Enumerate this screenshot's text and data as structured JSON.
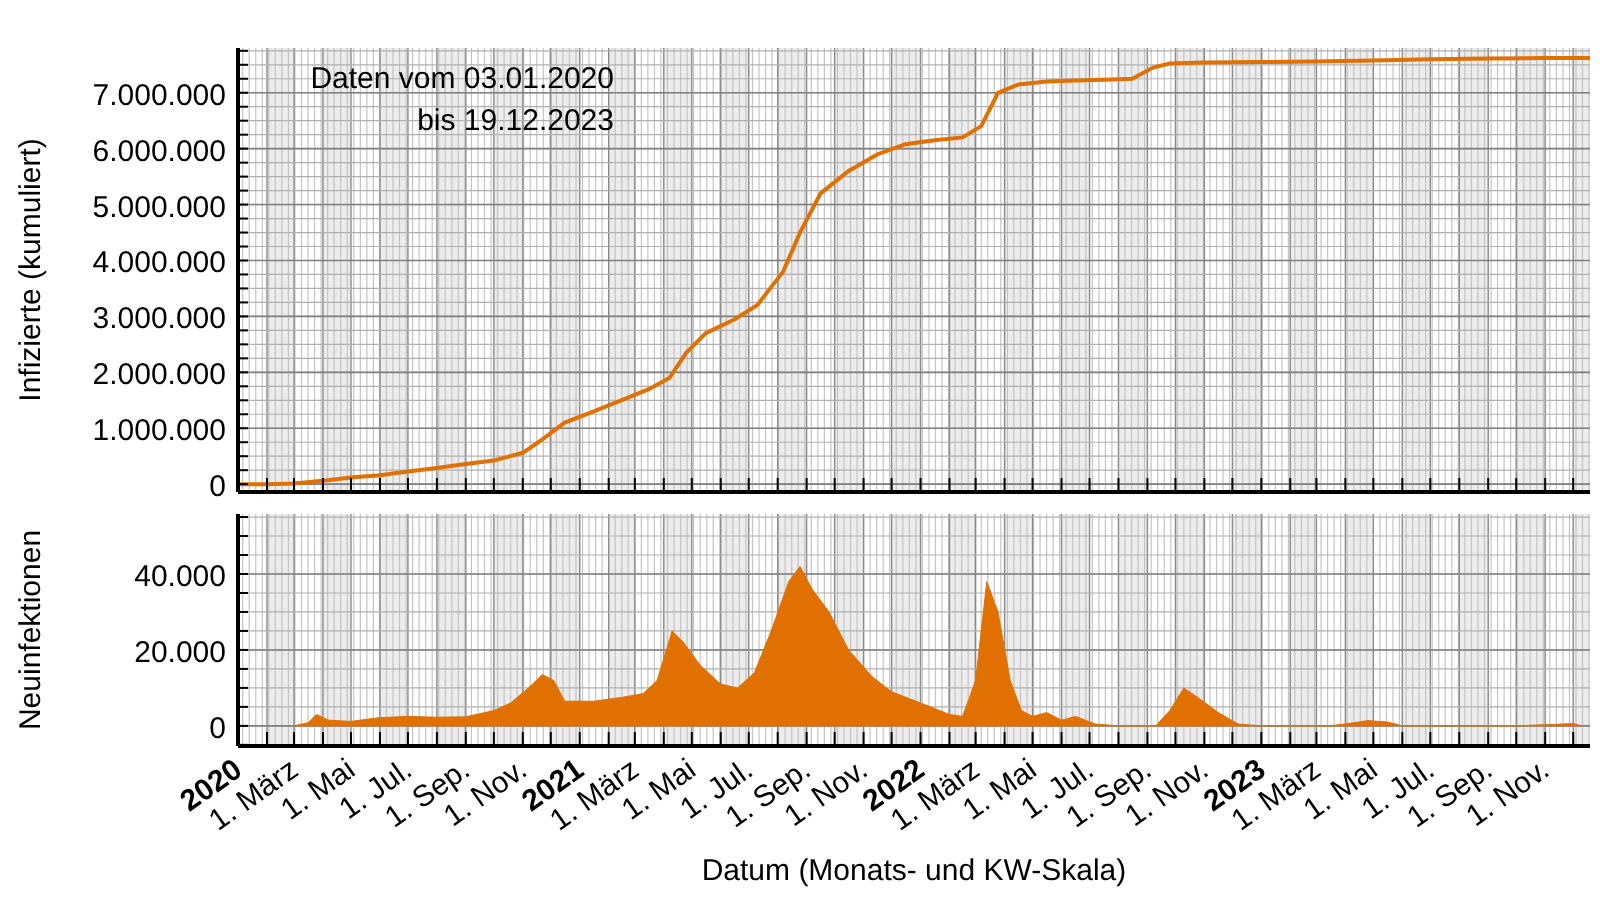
{
  "charts": [
    {
      "chart_data": {
        "type": "line",
        "grid": true,
        "ylabel": "Infizierte (kumuliert)",
        "xlim": [
          "2020-01-01",
          "2023-12-19"
        ],
        "ylim": [
          -140000,
          7800000
        ],
        "yticks": [
          {
            "value": 0,
            "label": "0"
          },
          {
            "value": 1000000,
            "label": "1.000.000"
          },
          {
            "value": 2000000,
            "label": "2.000.000"
          },
          {
            "value": 3000000,
            "label": "3.000.000"
          },
          {
            "value": 4000000,
            "label": "4.000.000"
          },
          {
            "value": 5000000,
            "label": "5.000.000"
          },
          {
            "value": 6000000,
            "label": "6.000.000"
          },
          {
            "value": 7000000,
            "label": "7.000.000"
          }
        ],
        "x": [
          "2020-01-01",
          "2020-02-01",
          "2020-03-01",
          "2020-04-01",
          "2020-05-01",
          "2020-06-01",
          "2020-07-01",
          "2020-08-01",
          "2020-09-01",
          "2020-10-01",
          "2020-11-01",
          "2020-11-22",
          "2020-12-16",
          "2021-01-16",
          "2021-02-15",
          "2021-03-16",
          "2021-04-07",
          "2021-04-25",
          "2021-05-16",
          "2021-06-16",
          "2021-07-10",
          "2021-08-07",
          "2021-08-25",
          "2021-09-16",
          "2021-10-16",
          "2021-11-16",
          "2021-12-16",
          "2022-01-16",
          "2022-02-15",
          "2022-03-07",
          "2022-03-25",
          "2022-04-16",
          "2022-05-16",
          "2022-06-16",
          "2022-07-16",
          "2022-08-16",
          "2022-09-07",
          "2022-09-25",
          "2022-11-01",
          "2023-01-01",
          "2023-03-01",
          "2023-05-01",
          "2023-07-01",
          "2023-09-01",
          "2023-11-01",
          "2023-12-19"
        ],
        "series": [
          {
            "color": "#e07000",
            "values": [
              0,
              0,
              10000,
              60000,
              120000,
              160000,
              230000,
              290000,
              360000,
              420000,
              560000,
              800000,
              1100000,
              1300000,
              1500000,
              1700000,
              1900000,
              2350000,
              2700000,
              2950000,
              3200000,
              3800000,
              4500000,
              5200000,
              5600000,
              5900000,
              6080000,
              6150000,
              6200000,
              6400000,
              7000000,
              7150000,
              7200000,
              7220000,
              7230000,
              7250000,
              7450000,
              7520000,
              7540000,
              7550000,
              7560000,
              7580000,
              7600000,
              7610000,
              7620000,
              7620000
            ]
          }
        ],
        "annotations": [
          "Daten vom 03.01.2020",
          "bis 19.12.2023"
        ]
      }
    },
    {
      "chart_data": {
        "type": "area",
        "grid": true,
        "xlabel": "Datum (Monats- und KW-Skala)",
        "ylabel": "Neuinfektionen",
        "xlim": [
          "2020-01-01",
          "2023-12-19"
        ],
        "ylim": [
          -5300,
          55800
        ],
        "yticks": [
          {
            "value": 0,
            "label": "0"
          },
          {
            "value": 20000,
            "label": "20.000"
          },
          {
            "value": 40000,
            "label": "40.000"
          }
        ],
        "xticks": [
          {
            "value": "2020-01-01",
            "label": "2020"
          },
          {
            "value": "2020-03-01",
            "label": "1. März"
          },
          {
            "value": "2020-05-01",
            "label": "1. Mai"
          },
          {
            "value": "2020-07-01",
            "label": "1. Jul."
          },
          {
            "value": "2020-09-01",
            "label": "1. Sep."
          },
          {
            "value": "2020-11-01",
            "label": "1. Nov."
          },
          {
            "value": "2021-01-01",
            "label": "2021"
          },
          {
            "value": "2021-03-01",
            "label": "1. März"
          },
          {
            "value": "2021-05-01",
            "label": "1. Mai"
          },
          {
            "value": "2021-07-01",
            "label": "1. Jul."
          },
          {
            "value": "2021-09-01",
            "label": "1. Sep."
          },
          {
            "value": "2021-11-01",
            "label": "1. Nov."
          },
          {
            "value": "2022-01-01",
            "label": "2022"
          },
          {
            "value": "2022-03-01",
            "label": "1. März"
          },
          {
            "value": "2022-05-01",
            "label": "1. Mai"
          },
          {
            "value": "2022-07-01",
            "label": "1. Jul."
          },
          {
            "value": "2022-09-01",
            "label": "1. Sep."
          },
          {
            "value": "2022-11-01",
            "label": "1. Nov."
          },
          {
            "value": "2023-01-01",
            "label": "2023"
          },
          {
            "value": "2023-03-01",
            "label": "1. März"
          },
          {
            "value": "2023-05-01",
            "label": "1. Mai"
          },
          {
            "value": "2023-07-01",
            "label": "1. Jul."
          },
          {
            "value": "2023-09-01",
            "label": "1. Sep."
          },
          {
            "value": "2023-11-01",
            "label": "1. Nov."
          }
        ],
        "x": [
          "2020-03-01",
          "2020-03-16",
          "2020-03-25",
          "2020-04-07",
          "2020-05-01",
          "2020-06-01",
          "2020-07-01",
          "2020-08-01",
          "2020-09-01",
          "2020-10-01",
          "2020-10-19",
          "2020-11-07",
          "2020-11-22",
          "2020-12-04",
          "2020-12-16",
          "2021-01-16",
          "2021-02-15",
          "2021-03-10",
          "2021-03-25",
          "2021-04-10",
          "2021-04-22",
          "2021-05-10",
          "2021-06-01",
          "2021-06-19",
          "2021-07-07",
          "2021-07-25",
          "2021-08-13",
          "2021-08-25",
          "2021-09-07",
          "2021-09-25",
          "2021-10-16",
          "2021-11-10",
          "2021-12-01",
          "2022-01-01",
          "2022-02-01",
          "2022-02-15",
          "2022-03-01",
          "2022-03-13",
          "2022-03-25",
          "2022-04-07",
          "2022-04-19",
          "2022-05-01",
          "2022-05-16",
          "2022-06-01",
          "2022-06-16",
          "2022-07-07",
          "2022-08-01",
          "2022-09-10",
          "2022-09-25",
          "2022-10-10",
          "2022-10-25",
          "2022-11-16",
          "2022-12-07",
          "2023-01-01",
          "2023-03-16",
          "2023-04-10",
          "2023-04-25",
          "2023-05-16",
          "2023-06-01",
          "2023-10-01",
          "2023-12-01",
          "2023-12-10"
        ],
        "series": [
          {
            "color": "#e07000",
            "values": [
              0,
              800,
              3000,
              1500,
              1200,
              2200,
              2500,
              2300,
              2400,
              4000,
              6000,
              10000,
              13500,
              12000,
              6500,
              6500,
              7500,
              8500,
              12000,
              25000,
              22000,
              16000,
              11000,
              10000,
              14000,
              25000,
              38000,
              42000,
              36000,
              30000,
              20000,
              13000,
              9000,
              6000,
              3000,
              2500,
              12000,
              38000,
              30000,
              12000,
              4000,
              2500,
              3500,
              1500,
              2500,
              500,
              0,
              0,
              4000,
              10000,
              7500,
              3500,
              500,
              0,
              0,
              800,
              1400,
              1000,
              0,
              0,
              600,
              0
            ]
          }
        ]
      }
    }
  ]
}
